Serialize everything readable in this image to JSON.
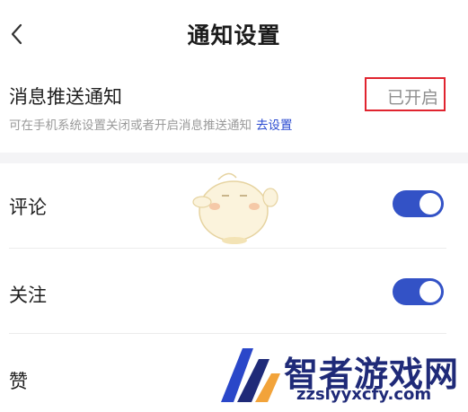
{
  "header": {
    "title": "通知设置"
  },
  "push": {
    "label": "消息推送通知",
    "status": "已开启",
    "hint": "可在手机系统设置关闭或者开启消息推送通知",
    "link": "去设置"
  },
  "settings": [
    {
      "label": "评论",
      "enabled": true
    },
    {
      "label": "关注",
      "enabled": true
    },
    {
      "label": "赞"
    }
  ],
  "watermark": {
    "brand": "智者游戏网",
    "url": "zzslyyxcfy.com"
  },
  "colors": {
    "toggle_on": "#3352c6",
    "link": "#2a4ad0",
    "highlight_box": "#e0242f"
  }
}
